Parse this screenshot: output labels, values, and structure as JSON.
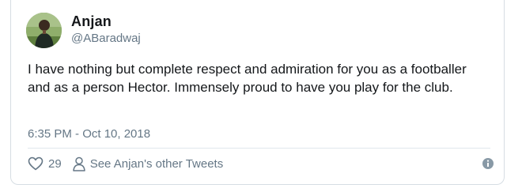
{
  "author": {
    "display_name": "Anjan",
    "handle": "@ABaradwaj",
    "avatar_icon": "user-avatar"
  },
  "tweet": {
    "text": "I have nothing but complete respect and admiration for you as a footballer and as a person Hector. Immensely proud to have you play for the club.",
    "timestamp": "6:35 PM - Oct 10, 2018"
  },
  "actions": {
    "like_icon": "heart-icon",
    "like_count": "29",
    "profile_icon": "person-icon",
    "profile_link_label": "See Anjan's other Tweets",
    "info_icon": "info-icon"
  },
  "colors": {
    "text_primary": "#14171a",
    "text_secondary": "#657786",
    "border": "#d6dde3"
  }
}
